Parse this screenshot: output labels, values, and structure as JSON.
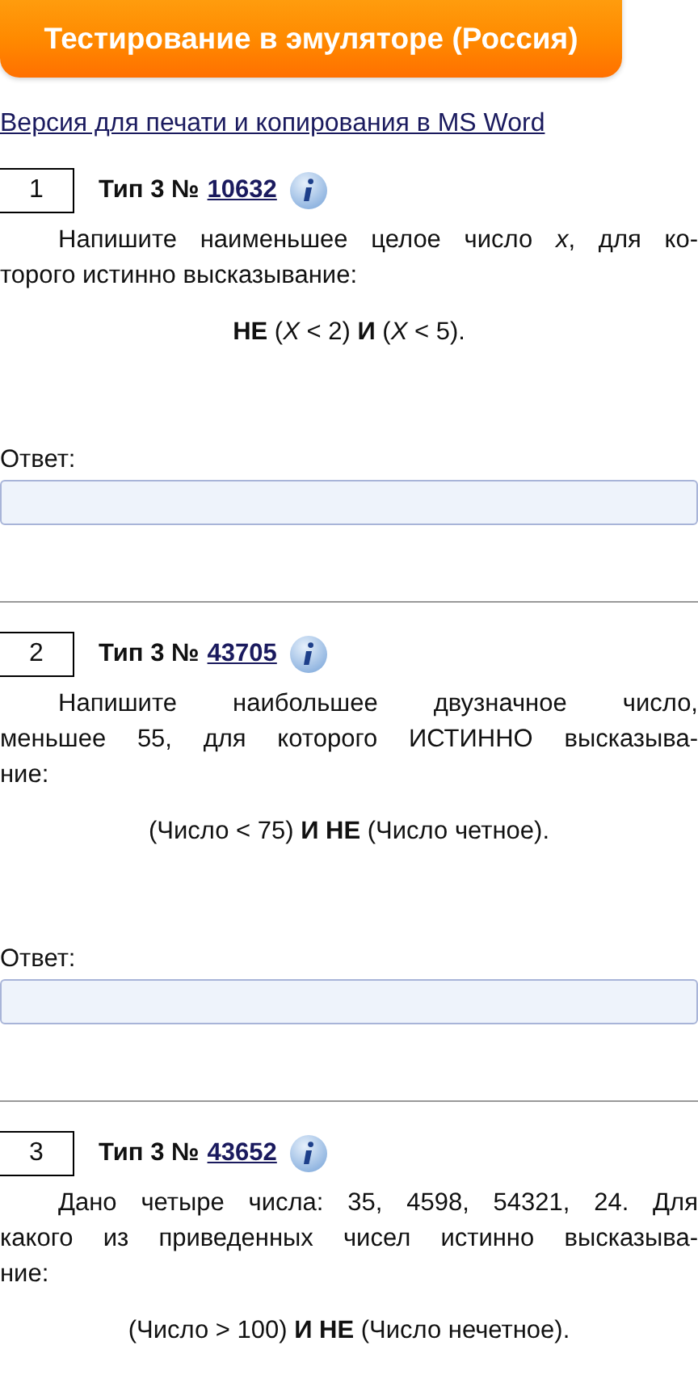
{
  "header_button": {
    "label": "Тестирование в эмуляторе (Россия)"
  },
  "print_link": {
    "label": "Версия для печати и копирования в MS Word"
  },
  "tasks": [
    {
      "number": "1",
      "type_label": "Тип 3 №",
      "task_id": "10632",
      "text_lines": [
        "Напишите наименьшее целое число *x*, для ко-",
        "торого истинно высказывание:"
      ],
      "expression": "**НЕ** (*X* < 2) **И** (*X* < 5).",
      "answer_label": "Ответ:"
    },
    {
      "number": "2",
      "type_label": "Тип 3 №",
      "task_id": "43705",
      "text_lines": [
        "Напишите наибольшее двузначное число,",
        "меньшее 55, для которого ИСТИННО высказыва-",
        "ние:"
      ],
      "expression": "(Число < 75) **И НЕ** (Число четное).",
      "answer_label": "Ответ:"
    },
    {
      "number": "3",
      "type_label": "Тип 3 №",
      "task_id": "43652",
      "text_lines": [
        "Дано четыре числа: 35, 4598, 54321, 24. Для",
        "какого из приведенных чисел истинно высказыва-",
        "ние:"
      ],
      "expression": "(Число > 100) **И НЕ** (Число нечетное)."
    }
  ]
}
